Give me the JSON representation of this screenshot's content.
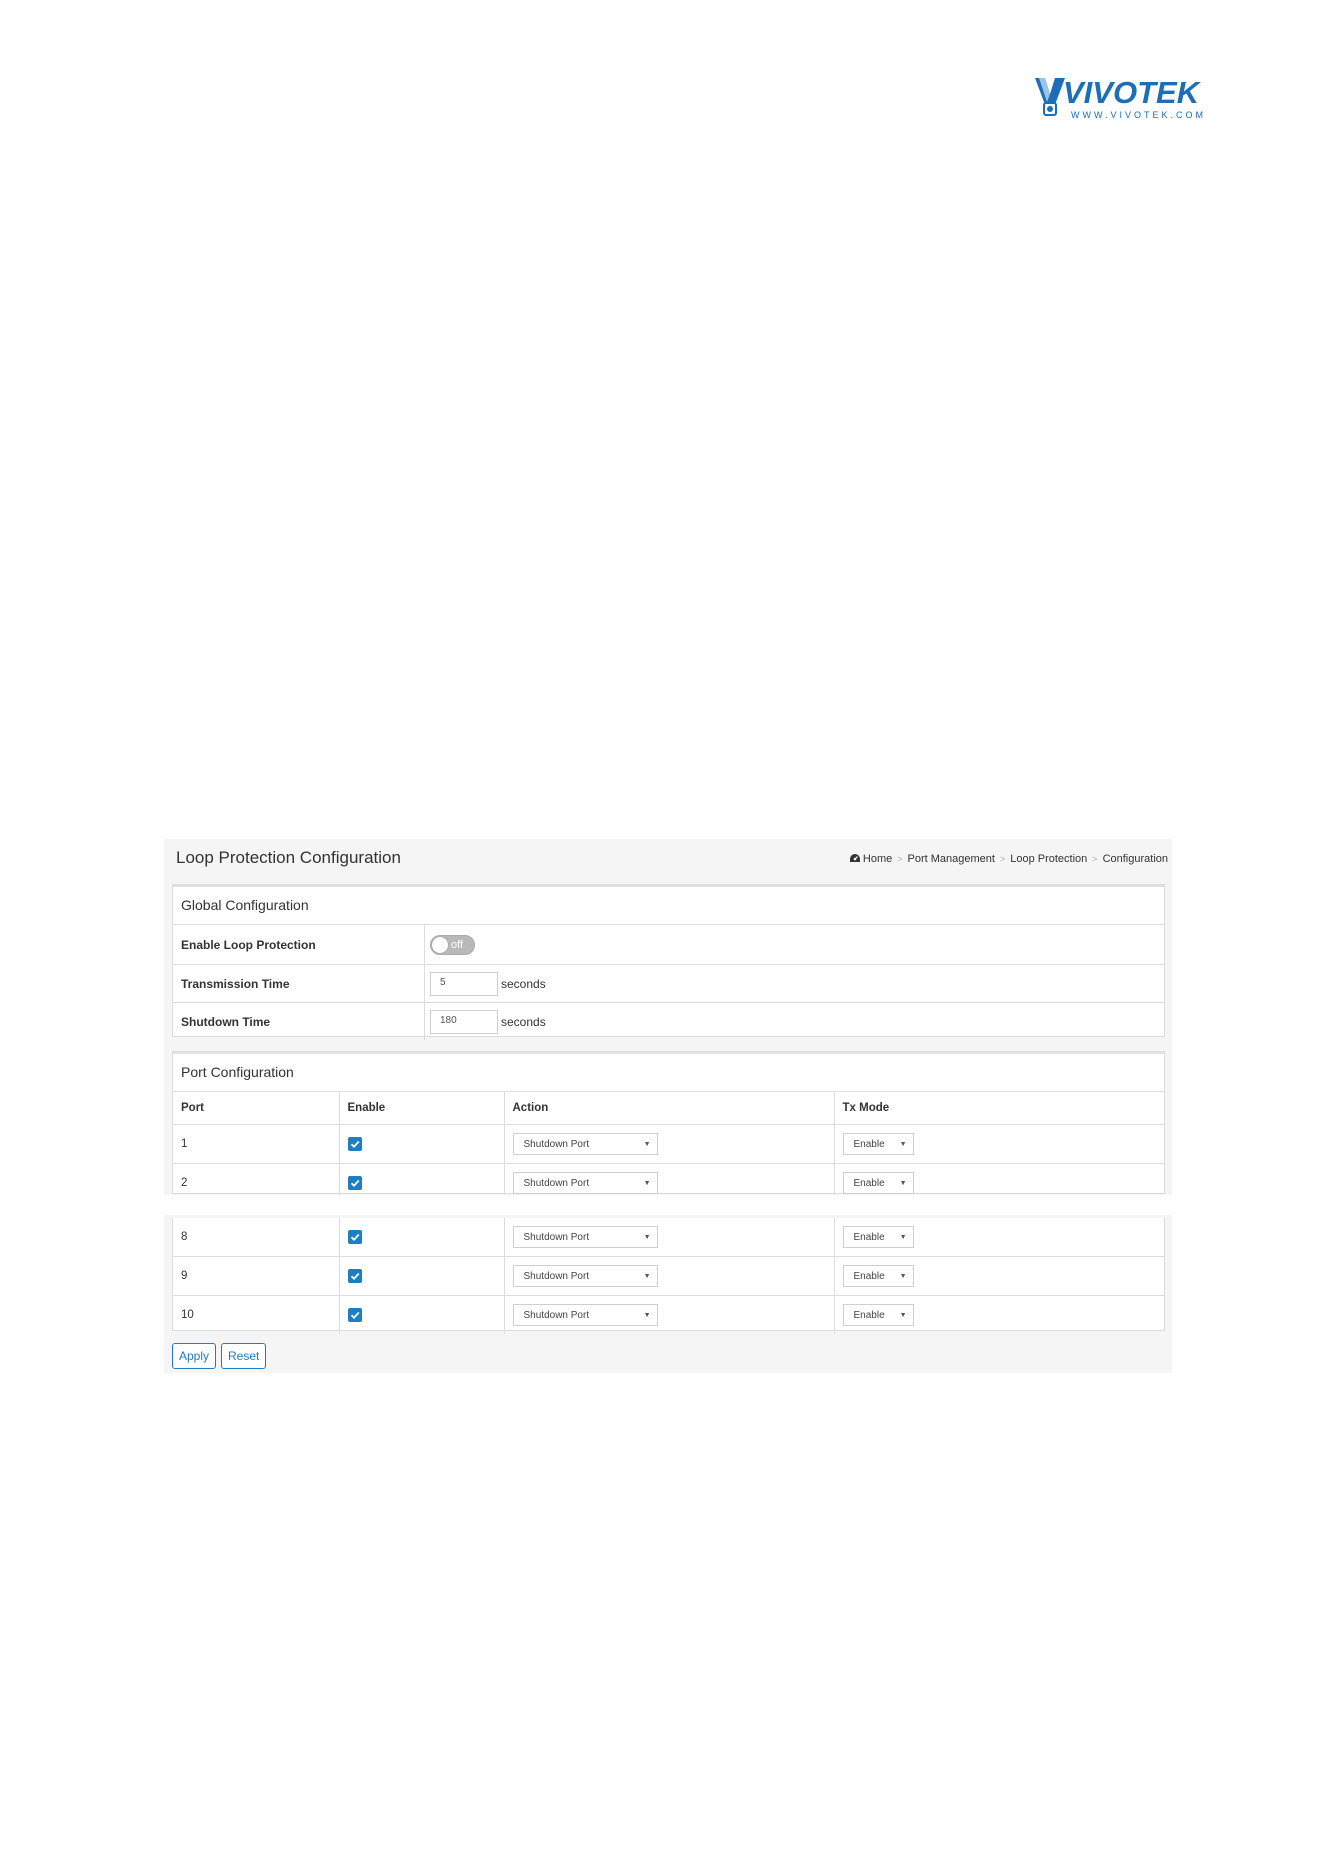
{
  "logo": {
    "brand": "VIVOTEK",
    "url": "WWW.VIVOTEK.COM"
  },
  "page": {
    "title": "Loop Protection Configuration",
    "breadcrumb": [
      "Home",
      "Port Management",
      "Loop Protection",
      "Configuration"
    ]
  },
  "global": {
    "heading": "Global Configuration",
    "enable_label": "Enable Loop Protection",
    "enable_state": "off",
    "transmission_label": "Transmission Time",
    "transmission_value": "5",
    "shutdown_label": "Shutdown Time",
    "shutdown_value": "180",
    "unit": "seconds"
  },
  "ports": {
    "heading": "Port Configuration",
    "columns": [
      "Port",
      "Enable",
      "Action",
      "Tx Mode"
    ],
    "rows_top": [
      {
        "port": "1",
        "enabled": true,
        "action": "Shutdown Port",
        "tx_mode": "Enable"
      },
      {
        "port": "2",
        "enabled": true,
        "action": "Shutdown Port",
        "tx_mode": "Enable"
      }
    ],
    "rows_bottom": [
      {
        "port": "8",
        "enabled": true,
        "action": "Shutdown Port",
        "tx_mode": "Enable"
      },
      {
        "port": "9",
        "enabled": true,
        "action": "Shutdown Port",
        "tx_mode": "Enable"
      },
      {
        "port": "10",
        "enabled": true,
        "action": "Shutdown Port",
        "tx_mode": "Enable"
      }
    ]
  },
  "buttons": {
    "apply": "Apply",
    "reset": "Reset"
  },
  "colors": {
    "accent": "#1d7ec4",
    "brand": "#1a6fb8",
    "panel_bg": "#f5f5f5"
  },
  "icons": {
    "home": "dashboard-icon",
    "check": "check-icon",
    "caret": "caret-down-icon"
  }
}
